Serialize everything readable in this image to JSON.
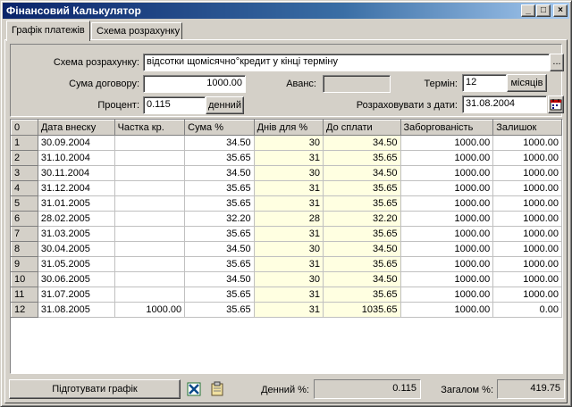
{
  "window": {
    "title": "Фінансовий Калькулятор",
    "minimize_glyph": "_",
    "maximize_glyph": "□",
    "close_glyph": "×"
  },
  "tabs": [
    {
      "label": "Графік платежів"
    },
    {
      "label": "Схема розрахунку"
    }
  ],
  "form": {
    "scheme_label": "Схема розрахунку:",
    "scheme_value": "відсотки щомісячно°кредит у кінці терміну",
    "scheme_button": "...",
    "amount_label": "Сума договору:",
    "amount_value": "1000.00",
    "advance_label": "Аванс:",
    "advance_value": "",
    "term_label": "Термін:",
    "term_value": "12",
    "term_unit_button": "місяців",
    "percent_label": "Процент:",
    "percent_value": "0.115",
    "percent_unit_button": "денний",
    "calc_from_label": "Розраховувати з дати:",
    "calc_from_value": "31.08.2004"
  },
  "table": {
    "columns": [
      "0",
      "Дата внеску",
      "Частка кр.",
      "Сума %",
      "Днів для %",
      "До сплати",
      "Заборгованість",
      "Залишок"
    ],
    "rows": [
      [
        "1",
        "30.09.2004",
        "",
        "34.50",
        "30",
        "34.50",
        "1000.00",
        "1000.00"
      ],
      [
        "2",
        "31.10.2004",
        "",
        "35.65",
        "31",
        "35.65",
        "1000.00",
        "1000.00"
      ],
      [
        "3",
        "30.11.2004",
        "",
        "34.50",
        "30",
        "34.50",
        "1000.00",
        "1000.00"
      ],
      [
        "4",
        "31.12.2004",
        "",
        "35.65",
        "31",
        "35.65",
        "1000.00",
        "1000.00"
      ],
      [
        "5",
        "31.01.2005",
        "",
        "35.65",
        "31",
        "35.65",
        "1000.00",
        "1000.00"
      ],
      [
        "6",
        "28.02.2005",
        "",
        "32.20",
        "28",
        "32.20",
        "1000.00",
        "1000.00"
      ],
      [
        "7",
        "31.03.2005",
        "",
        "35.65",
        "31",
        "35.65",
        "1000.00",
        "1000.00"
      ],
      [
        "8",
        "30.04.2005",
        "",
        "34.50",
        "30",
        "34.50",
        "1000.00",
        "1000.00"
      ],
      [
        "9",
        "31.05.2005",
        "",
        "35.65",
        "31",
        "35.65",
        "1000.00",
        "1000.00"
      ],
      [
        "10",
        "30.06.2005",
        "",
        "34.50",
        "30",
        "34.50",
        "1000.00",
        "1000.00"
      ],
      [
        "11",
        "31.07.2005",
        "",
        "35.65",
        "31",
        "35.65",
        "1000.00",
        "1000.00"
      ],
      [
        "12",
        "31.08.2005",
        "1000.00",
        "35.65",
        "31",
        "1035.65",
        "1000.00",
        "0.00"
      ]
    ]
  },
  "footer": {
    "prepare_button": "Підготувати графік",
    "daily_label": "Денний %:",
    "daily_value": "0.115",
    "total_label": "Загалом %:",
    "total_value": "419.75"
  },
  "colors": {
    "title_start": "#0a246a",
    "title_end": "#a6caf0",
    "highlight_column": "#ffffe1",
    "face": "#d4d0c8"
  },
  "icons": {
    "excel": "excel-icon",
    "clipboard": "clipboard-icon",
    "calendar": "calendar-icon"
  }
}
